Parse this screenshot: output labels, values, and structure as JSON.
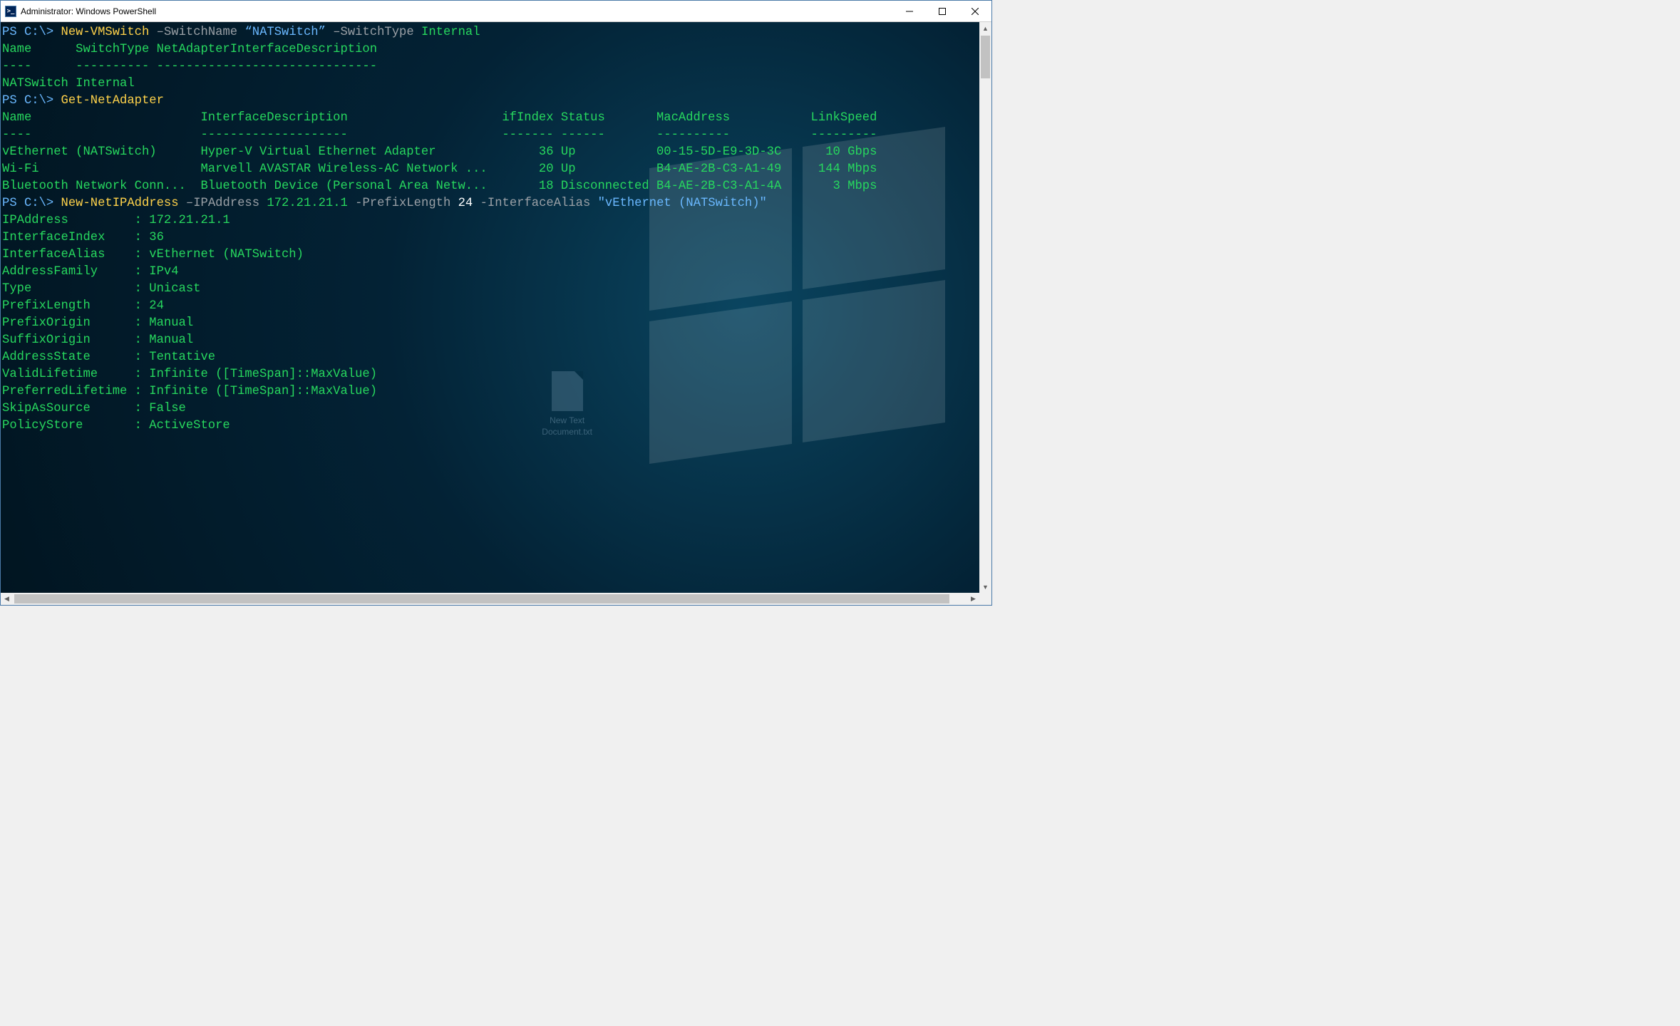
{
  "window": {
    "title": "Administrator: Windows PowerShell",
    "controls": {
      "min": "minimize",
      "max": "maximize",
      "close": "close"
    },
    "ps_icon_text": ">_"
  },
  "desktop_bg": {
    "file_label_line1": "New Text",
    "file_label_line2": "Document.txt"
  },
  "cmd1": {
    "prompt": "PS C:\\>",
    "cmdlet": "New-VMSwitch",
    "p_name": "–SwitchName",
    "v_name": "“NATSwitch”",
    "p_type": "–SwitchType",
    "v_type": "Internal"
  },
  "vmswitch_table": {
    "headers": {
      "c1": "Name",
      "c2": "SwitchType",
      "c3": "NetAdapterInterfaceDescription"
    },
    "dashes": {
      "c1": "----",
      "c2": "----------",
      "c3": "------------------------------"
    },
    "row": {
      "c1": "NATSwitch",
      "c2": "Internal",
      "c3": ""
    }
  },
  "cmd2": {
    "prompt": "PS C:\\>",
    "cmdlet": "Get-NetAdapter"
  },
  "adapter_table": {
    "headers": {
      "c1": "Name",
      "c2": "InterfaceDescription",
      "c3": "ifIndex",
      "c4": "Status",
      "c5": "MacAddress",
      "c6": "LinkSpeed"
    },
    "dashes": {
      "c1": "----",
      "c2": "--------------------",
      "c3": "-------",
      "c4": "------",
      "c5": "----------",
      "c6": "---------"
    },
    "rows": [
      {
        "c1": "vEthernet (NATSwitch)",
        "c2": "Hyper-V Virtual Ethernet Adapter",
        "c3": "36",
        "c4": "Up",
        "c5": "00-15-5D-E9-3D-3C",
        "c6": "10 Gbps"
      },
      {
        "c1": "Wi-Fi",
        "c2": "Marvell AVASTAR Wireless-AC Network ...",
        "c3": "20",
        "c4": "Up",
        "c5": "B4-AE-2B-C3-A1-49",
        "c6": "144 Mbps"
      },
      {
        "c1": "Bluetooth Network Conn...",
        "c2": "Bluetooth Device (Personal Area Netw...",
        "c3": "18",
        "c4": "Disconnected",
        "c5": "B4-AE-2B-C3-A1-4A",
        "c6": "3 Mbps"
      }
    ]
  },
  "cmd3": {
    "prompt": "PS C:\\>",
    "cmdlet": "New-NetIPAddress",
    "p_ip": "–IPAddress",
    "v_ip": "172.21.21.1",
    "p_pref": "-PrefixLength",
    "v_pref": "24",
    "p_ifalias": "-InterfaceAlias",
    "v_ifalias": "\"vEthernet (NATSwitch)\""
  },
  "ipresult": {
    "rows": [
      {
        "k": "IPAddress",
        "v": "172.21.21.1"
      },
      {
        "k": "InterfaceIndex",
        "v": "36"
      },
      {
        "k": "InterfaceAlias",
        "v": "vEthernet (NATSwitch)"
      },
      {
        "k": "AddressFamily",
        "v": "IPv4"
      },
      {
        "k": "Type",
        "v": "Unicast"
      },
      {
        "k": "PrefixLength",
        "v": "24"
      },
      {
        "k": "PrefixOrigin",
        "v": "Manual"
      },
      {
        "k": "SuffixOrigin",
        "v": "Manual"
      },
      {
        "k": "AddressState",
        "v": "Tentative"
      },
      {
        "k": "ValidLifetime",
        "v": "Infinite ([TimeSpan]::MaxValue)"
      },
      {
        "k": "PreferredLifetime",
        "v": "Infinite ([TimeSpan]::MaxValue)"
      },
      {
        "k": "SkipAsSource",
        "v": "False"
      },
      {
        "k": "PolicyStore",
        "v": "ActiveStore"
      }
    ]
  }
}
